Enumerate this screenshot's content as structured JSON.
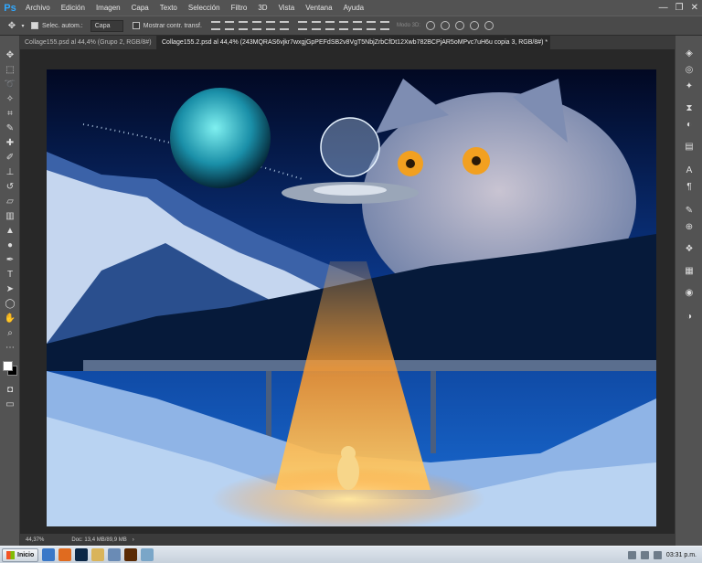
{
  "app": {
    "logo": "Ps",
    "menu": [
      "Archivo",
      "Edición",
      "Imagen",
      "Capa",
      "Texto",
      "Selección",
      "Filtro",
      "3D",
      "Vista",
      "Ventana",
      "Ayuda"
    ],
    "window_controls": [
      "—",
      "❐",
      "✕"
    ]
  },
  "options": {
    "auto_select_label": "Selec. autom.:",
    "auto_select_value": "Capa",
    "transform_label": "Mostrar contr. transf.",
    "mode3d_label": "Modo 3D:"
  },
  "tabs": [
    {
      "label": "Collage155.psd al 44,4% (Grupo 2, RGB/8#)",
      "close": "×"
    },
    {
      "label": "Collage155.2.psd al 44,4% (243MQRAS6vjkr7wxgjGpPEFdSB2v8VgT5NbjZrbCfDt12Xwb782BCPjAR5oMPvc7uH6u copia 3, RGB/8#) *",
      "close": "×"
    }
  ],
  "status": {
    "zoom": "44,37%",
    "doc": "Doc: 13,4 MB/89,9 MB",
    "arrow": "›"
  },
  "taskbar": {
    "start_label": "Inicio",
    "time": "03:31 p.m."
  },
  "icons": {
    "toolbar": [
      "move-icon",
      "marquee-icon",
      "lasso-icon",
      "magic-wand-icon",
      "crop-icon",
      "eyedropper-icon",
      "healing-icon",
      "brush-icon",
      "stamp-icon",
      "history-brush-icon",
      "eraser-icon",
      "gradient-icon",
      "blur-icon",
      "dodge-icon",
      "pen-icon",
      "type-icon",
      "path-select-icon",
      "shape-icon",
      "hand-icon",
      "zoom-icon",
      "more-icon"
    ],
    "rightbar": [
      "layers-icon",
      "channels-icon",
      "paths-icon",
      "history-icon",
      "adjustments-icon",
      "character-icon",
      "paragraph-icon",
      "clone-source-icon",
      "brush-preset-icon",
      "3d-icon",
      "swatches-icon",
      "styles-icon",
      "properties-icon"
    ]
  },
  "colors": {
    "accent": "#31a8ff"
  }
}
